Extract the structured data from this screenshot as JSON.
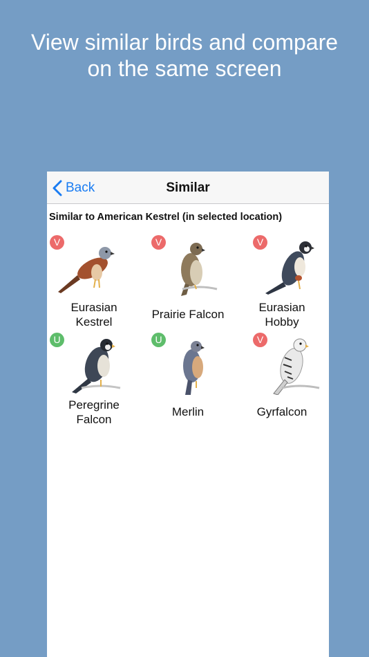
{
  "headline": {
    "line1": "View similar birds and compare",
    "line2": "on the same screen"
  },
  "navbar": {
    "back_label": "Back",
    "title": "Similar"
  },
  "subtitle": "Similar to American Kestrel (in selected location)",
  "status_colors": {
    "V": "#ec6a6a",
    "U": "#5ebd6b"
  },
  "birds": [
    {
      "line1": "Eurasian",
      "line2": "Kestrel",
      "badge": "V",
      "icon": "eurasian-kestrel-illustration"
    },
    {
      "line1": "Prairie Falcon",
      "line2": "",
      "badge": "V",
      "icon": "prairie-falcon-illustration"
    },
    {
      "line1": "Eurasian",
      "line2": "Hobby",
      "badge": "V",
      "icon": "eurasian-hobby-illustration"
    },
    {
      "line1": "Peregrine",
      "line2": "Falcon",
      "badge": "U",
      "icon": "peregrine-falcon-illustration"
    },
    {
      "line1": "Merlin",
      "line2": "",
      "badge": "U",
      "icon": "merlin-illustration"
    },
    {
      "line1": "Gyrfalcon",
      "line2": "",
      "badge": "V",
      "icon": "gyrfalcon-illustration"
    }
  ]
}
